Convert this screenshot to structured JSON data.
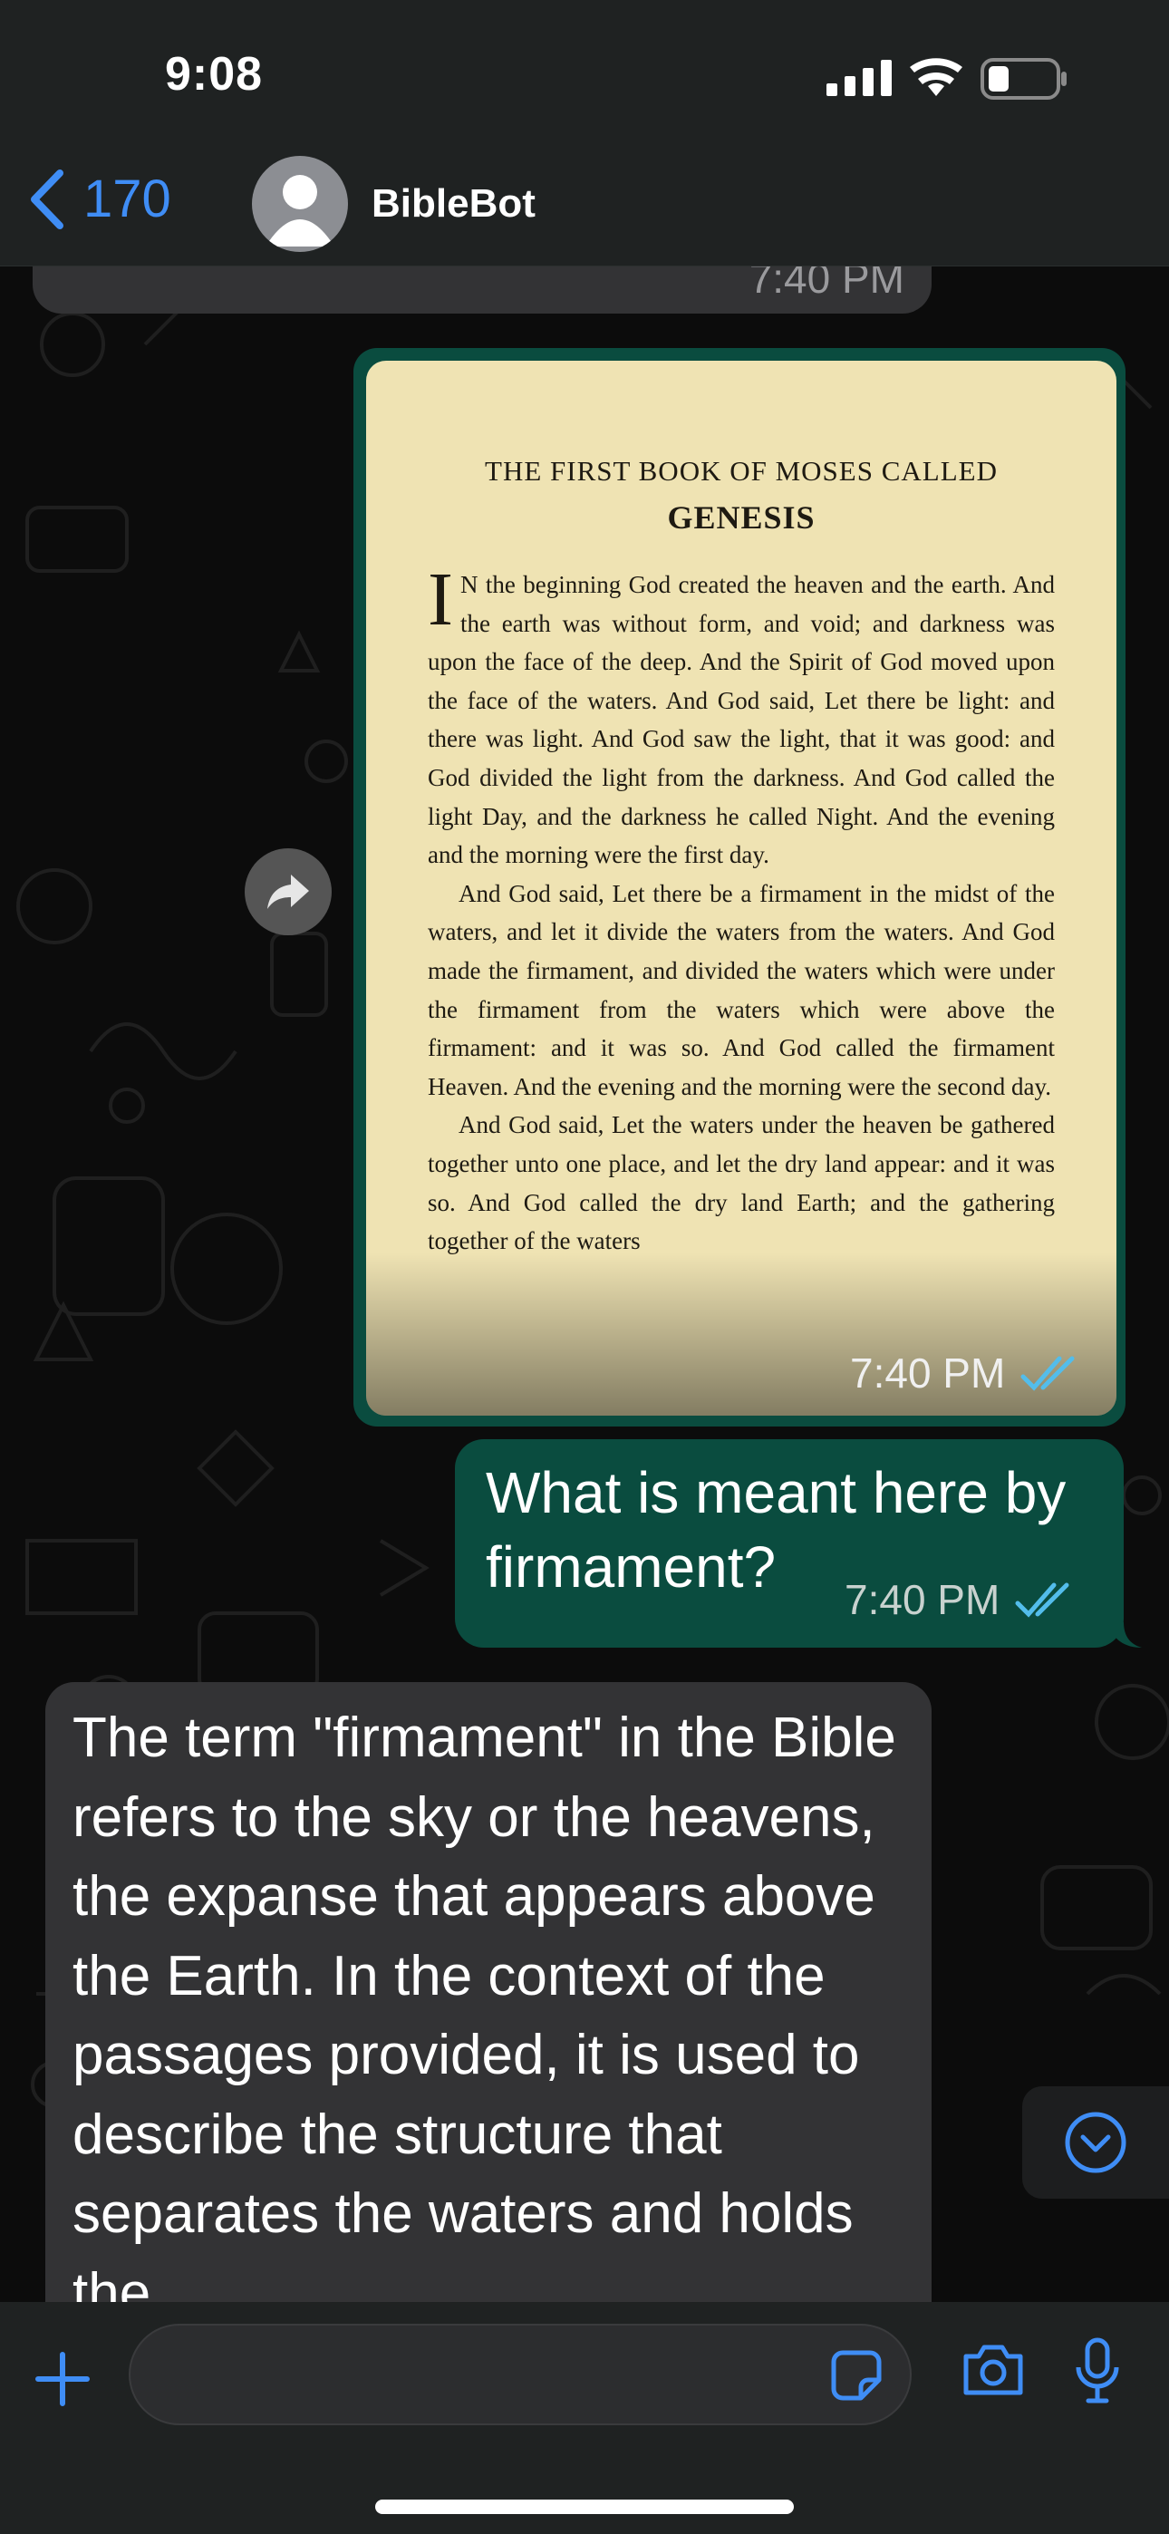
{
  "status_bar": {
    "time": "9:08"
  },
  "header": {
    "back_count": "170",
    "chat_name": "BibleBot"
  },
  "messages": [
    {
      "id": "prev-in",
      "direction": "incoming",
      "time": "7:40 PM"
    },
    {
      "id": "image-out",
      "direction": "outgoing",
      "time": "7:40 PM",
      "status": "read",
      "image": {
        "heading": "THE FIRST BOOK OF MOSES CALLED",
        "title": "GENESIS",
        "drop_cap": "I",
        "paragraphs": [
          "N the beginning God created the heaven and the earth. And the earth was without form, and void; and darkness was upon the face of the deep. And the Spirit of God moved upon the face of the waters. And God said, Let there be light: and there was light. And God saw the light, that it was good: and God divided the light from the darkness. And God called the light Day, and the darkness he called Night. And the evening and the morning were the first day.",
          "And God said, Let there be a firmament in the midst of the waters, and let it divide the waters from the waters. And God made the firmament, and divided the waters which were under the firmament from the waters which were above the firmament: and it was so. And God called the firmament Heaven. And the evening and the morning were the second day.",
          "And God said, Let the waters under the heaven be gathered together unto one place, and let the dry land appear: and it was so. And God called the dry land Earth; and the gathering together of the waters"
        ]
      }
    },
    {
      "id": "question",
      "direction": "outgoing",
      "text": "What is meant here by firmament?",
      "time": "7:40 PM",
      "status": "read"
    },
    {
      "id": "answer",
      "direction": "incoming",
      "text": "The term \"firmament\" in the Bible refers to the sky or the heavens, the expanse that appears above the Earth. In the context of the passages provided, it is used to describe the structure that separates the waters and holds the"
    }
  ],
  "composer": {
    "placeholder": ""
  },
  "colors": {
    "outgoing_bubble": "#0a4c3f",
    "incoming_bubble": "#333335",
    "accent": "#3f8df5",
    "read_ticks": "#53bdeb",
    "bar_background": "#1f2222"
  },
  "icons": [
    "back-chevron-icon",
    "avatar-person-icon",
    "forward-icon",
    "read-ticks-icon",
    "scroll-down-icon",
    "plus-icon",
    "sticker-icon",
    "camera-icon",
    "microphone-icon",
    "signal-icon",
    "wifi-icon",
    "battery-icon"
  ]
}
